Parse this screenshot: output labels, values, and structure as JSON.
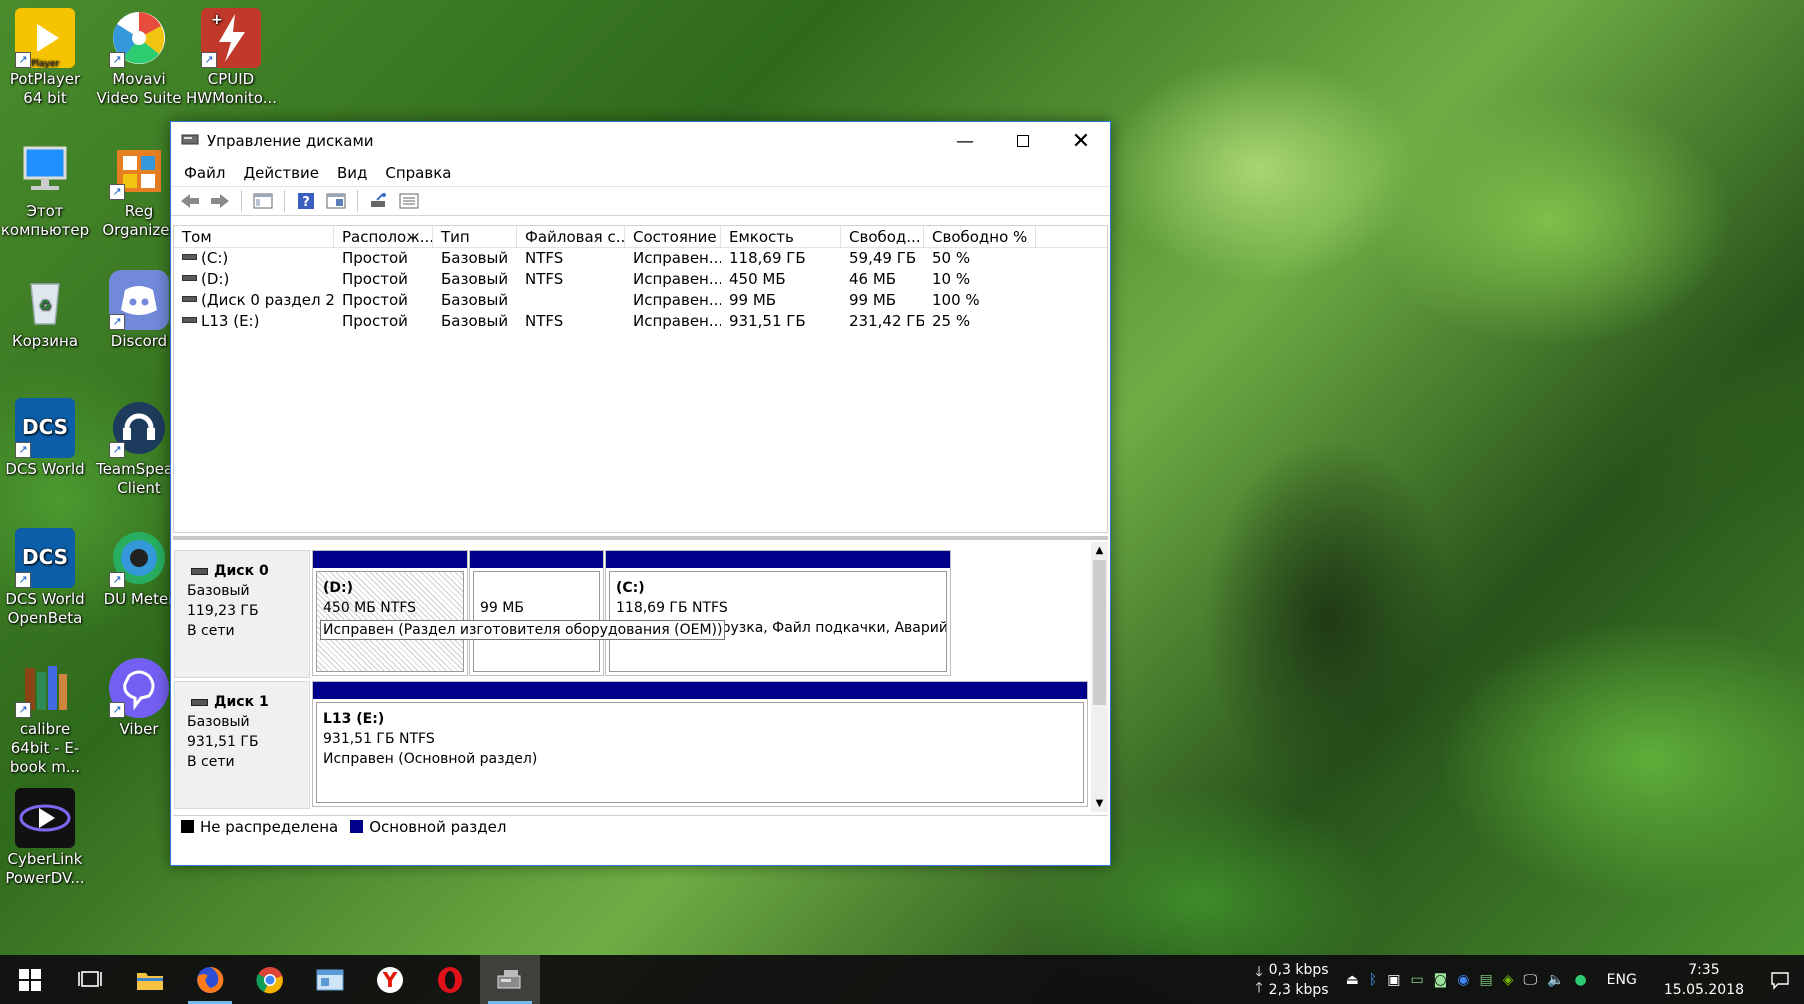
{
  "desktop": {
    "icons": [
      {
        "label": "PotPlayer 64 bit",
        "icon": "potplayer-icon"
      },
      {
        "label": "Movavi Video Suite",
        "icon": "movavi-icon"
      },
      {
        "label": "CPUID HWMonito...",
        "icon": "cpuid-icon"
      },
      {
        "label": "Этот компьютер",
        "icon": "computer-icon"
      },
      {
        "label": "Reg Organizer",
        "icon": "reg-organizer-icon"
      },
      {
        "label": "Корзина",
        "icon": "recycle-bin-icon"
      },
      {
        "label": "Discord",
        "icon": "discord-icon"
      },
      {
        "label": "DCS World",
        "icon": "dcs-icon"
      },
      {
        "label": "TeamSpeak Client",
        "icon": "teamspeak-icon"
      },
      {
        "label": "DCS World OpenBeta",
        "icon": "dcs-openbeta-icon"
      },
      {
        "label": "DU Meter",
        "icon": "du-meter-icon"
      },
      {
        "label": "calibre 64bit - E-book m...",
        "icon": "calibre-icon"
      },
      {
        "label": "Viber",
        "icon": "viber-icon"
      },
      {
        "label": "CyberLink PowerDV...",
        "icon": "cyberlink-icon"
      }
    ]
  },
  "window": {
    "title": "Управление дисками",
    "menu": [
      "Файл",
      "Действие",
      "Вид",
      "Справка"
    ],
    "list": {
      "columns": [
        "Том",
        "Располож...",
        "Тип",
        "Файловая с...",
        "Состояние",
        "Емкость",
        "Свобод...",
        "Свободно %"
      ],
      "rows": [
        [
          "(C:)",
          "Простой",
          "Базовый",
          "NTFS",
          "Исправен...",
          "118,69 ГБ",
          "59,49 ГБ",
          "50 %"
        ],
        [
          "(D:)",
          "Простой",
          "Базовый",
          "NTFS",
          "Исправен...",
          "450 МБ",
          "46 МБ",
          "10 %"
        ],
        [
          "(Диск 0 раздел 2)",
          "Простой",
          "Базовый",
          "",
          "Исправен...",
          "99 МБ",
          "99 МБ",
          "100 %"
        ],
        [
          "L13 (E:)",
          "Простой",
          "Базовый",
          "NTFS",
          "Исправен...",
          "931,51 ГБ",
          "231,42 ГБ",
          "25 %"
        ]
      ]
    },
    "disks": [
      {
        "name": "Диск 0",
        "type": "Базовый",
        "size": "119,23 ГБ",
        "status": "В сети",
        "partitions": [
          {
            "title": "(D:)",
            "size": "450 МБ NTFS",
            "status": "Исправен (Раздел изготовителя оборудования (OEM))"
          },
          {
            "title": "",
            "size": "99 МБ",
            "status": ""
          },
          {
            "title": "(C:)",
            "size": "118,69 ГБ NTFS",
            "status": "Исправен (Загрузка, Файл подкачки, Аварийн"
          }
        ]
      },
      {
        "name": "Диск 1",
        "type": "Базовый",
        "size": "931,51 ГБ",
        "status": "В сети",
        "partitions": [
          {
            "title": "L13  (E:)",
            "size": "931,51 ГБ NTFS",
            "status": "Исправен (Основной раздел)"
          }
        ]
      }
    ],
    "tooltip": "Исправен (Раздел изготовителя оборудования (OEM))",
    "legend": [
      {
        "label": "Не распределена",
        "color": "#000000"
      },
      {
        "label": "Основной раздел",
        "color": "#00008b"
      }
    ]
  },
  "taskbar": {
    "net_down": "0,3 kbps",
    "net_up": "2,3 kbps",
    "lang": "ENG",
    "time": "7:35",
    "date": "15.05.2018"
  }
}
